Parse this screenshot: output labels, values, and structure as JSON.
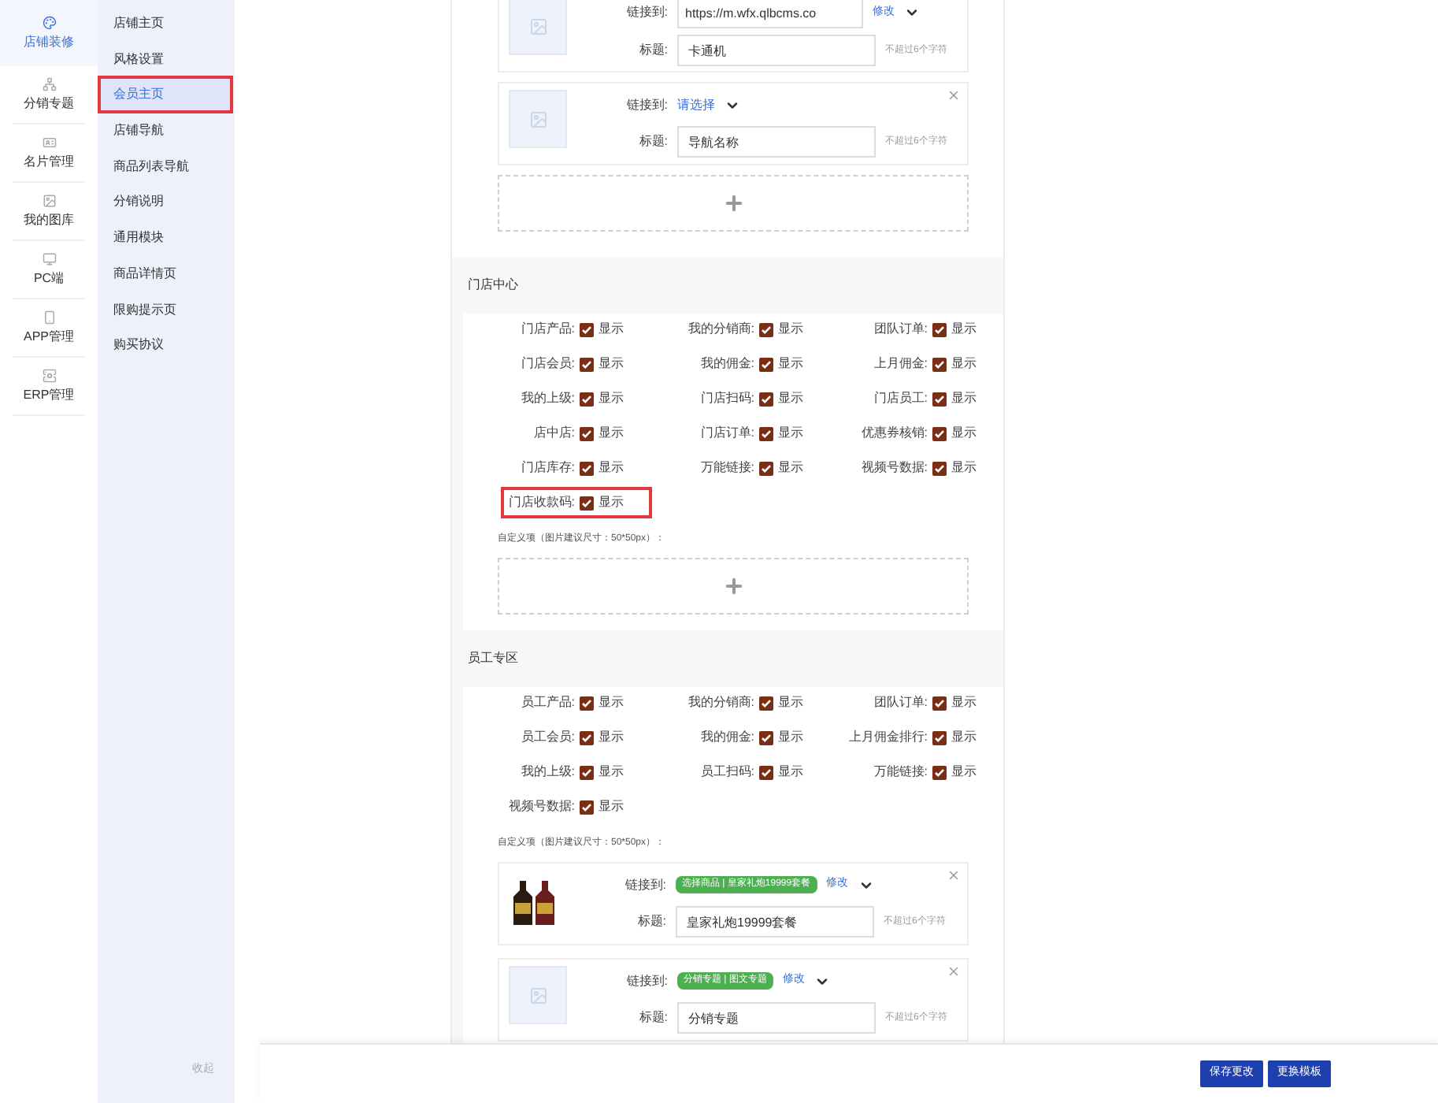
{
  "main_nav": [
    {
      "label": "店铺装修",
      "selected": true
    },
    {
      "label": "分销专题",
      "selected": false
    },
    {
      "label": "名片管理",
      "selected": false
    },
    {
      "label": "我的图库",
      "selected": false
    },
    {
      "label": "PC端",
      "selected": false
    },
    {
      "label": "APP管理",
      "selected": false
    },
    {
      "label": "ERP管理",
      "selected": false
    }
  ],
  "sub_nav": {
    "items": [
      {
        "label": "店铺主页",
        "selected": false,
        "highlighted": false
      },
      {
        "label": "风格设置",
        "selected": false,
        "highlighted": false
      },
      {
        "label": "会员主页",
        "selected": true,
        "highlighted": true
      },
      {
        "label": "店铺导航",
        "selected": false,
        "highlighted": false
      },
      {
        "label": "商品列表导航",
        "selected": false,
        "highlighted": false
      },
      {
        "label": "分销说明",
        "selected": false,
        "highlighted": false
      },
      {
        "label": "通用模块",
        "selected": false,
        "highlighted": false
      },
      {
        "label": "商品详情页",
        "selected": false,
        "highlighted": false
      },
      {
        "label": "限购提示页",
        "selected": false,
        "highlighted": false
      },
      {
        "label": "购买协议",
        "selected": false,
        "highlighted": false
      }
    ],
    "collapse": "收起"
  },
  "nav_cards": [
    {
      "kind": "placeholder",
      "closable": false,
      "link_label": "链接到:",
      "link_url": "https://m.wfx.qlbcms.co",
      "edit": "修改",
      "title_label": "标题:",
      "title_value": "卡通机",
      "hint": "不超过6个字符"
    },
    {
      "kind": "placeholder",
      "closable": true,
      "link_label": "链接到:",
      "link_select": "请选择",
      "title_label": "标题:",
      "title_value": "导航名称",
      "hint": "不超过6个字符"
    }
  ],
  "store_center": {
    "title": "门店中心",
    "toggles": [
      {
        "label": "门店产品:",
        "option": "显示",
        "checked": true,
        "highlighted": false
      },
      {
        "label": "我的分销商:",
        "option": "显示",
        "checked": true,
        "highlighted": false
      },
      {
        "label": "团队订单:",
        "option": "显示",
        "checked": true,
        "highlighted": false
      },
      {
        "label": "门店会员:",
        "option": "显示",
        "checked": true,
        "highlighted": false
      },
      {
        "label": "我的佣金:",
        "option": "显示",
        "checked": true,
        "highlighted": false
      },
      {
        "label": "上月佣金:",
        "option": "显示",
        "checked": true,
        "highlighted": false
      },
      {
        "label": "我的上级:",
        "option": "显示",
        "checked": true,
        "highlighted": false
      },
      {
        "label": "门店扫码:",
        "option": "显示",
        "checked": true,
        "highlighted": false
      },
      {
        "label": "门店员工:",
        "option": "显示",
        "checked": true,
        "highlighted": false
      },
      {
        "label": "店中店:",
        "option": "显示",
        "checked": true,
        "highlighted": false
      },
      {
        "label": "门店订单:",
        "option": "显示",
        "checked": true,
        "highlighted": false
      },
      {
        "label": "优惠券核销:",
        "option": "显示",
        "checked": true,
        "highlighted": false
      },
      {
        "label": "门店库存:",
        "option": "显示",
        "checked": true,
        "highlighted": false
      },
      {
        "label": "万能链接:",
        "option": "显示",
        "checked": true,
        "highlighted": false
      },
      {
        "label": "视频号数据:",
        "option": "显示",
        "checked": true,
        "highlighted": false
      },
      {
        "label": "门店收款码:",
        "option": "显示",
        "checked": true,
        "highlighted": true
      }
    ],
    "custom_label": "自定义项（图片建议尺寸：50*50px）："
  },
  "staff_zone": {
    "title": "员工专区",
    "toggles": [
      {
        "label": "员工产品:",
        "option": "显示",
        "checked": true,
        "highlighted": false
      },
      {
        "label": "我的分销商:",
        "option": "显示",
        "checked": true,
        "highlighted": false
      },
      {
        "label": "团队订单:",
        "option": "显示",
        "checked": true,
        "highlighted": false
      },
      {
        "label": "员工会员:",
        "option": "显示",
        "checked": true,
        "highlighted": false
      },
      {
        "label": "我的佣金:",
        "option": "显示",
        "checked": true,
        "highlighted": false
      },
      {
        "label": "上月佣金排行:",
        "option": "显示",
        "checked": true,
        "highlighted": false
      },
      {
        "label": "我的上级:",
        "option": "显示",
        "checked": true,
        "highlighted": false
      },
      {
        "label": "员工扫码:",
        "option": "显示",
        "checked": true,
        "highlighted": false
      },
      {
        "label": "万能链接:",
        "option": "显示",
        "checked": true,
        "highlighted": false
      },
      {
        "label": "视频号数据:",
        "option": "显示",
        "checked": true,
        "highlighted": false
      }
    ],
    "custom_label": "自定义项（图片建议尺寸：50*50px）：",
    "cards": [
      {
        "kind": "photo",
        "closable": true,
        "link_label": "链接到:",
        "link_tag": "选择商品 | 皇家礼炮19999套餐",
        "edit": "修改",
        "title_label": "标题:",
        "title_value": "皇家礼炮19999套餐",
        "hint": "不超过6个字符"
      },
      {
        "kind": "placeholder",
        "closable": true,
        "link_label": "链接到:",
        "link_tag": "分销专题 | 图文专题",
        "edit": "修改",
        "title_label": "标题:",
        "title_value": "分销专题",
        "hint": "不超过6个字符"
      }
    ]
  },
  "footer": {
    "buttons": [
      "保存更改",
      "更换模板"
    ]
  }
}
